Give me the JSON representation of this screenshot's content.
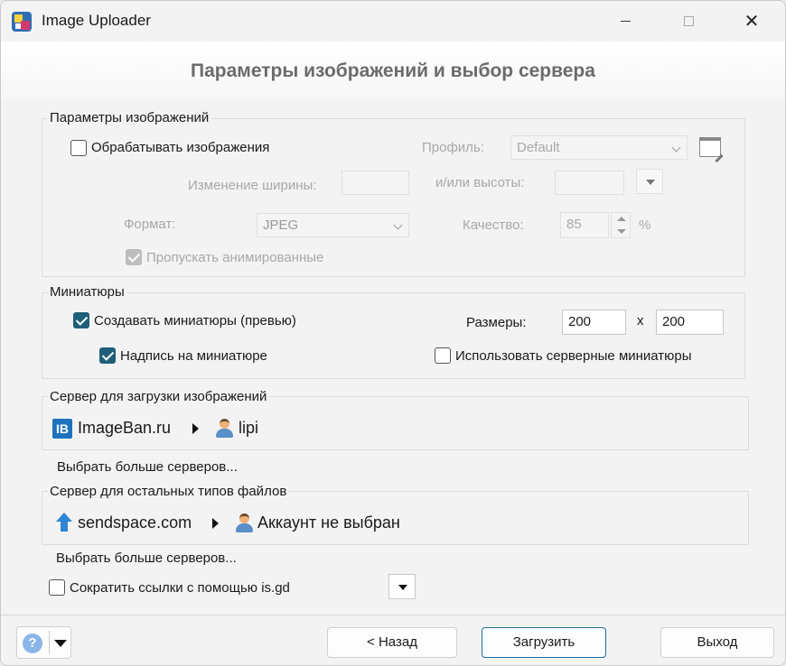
{
  "window": {
    "title": "Image Uploader",
    "header": "Параметры изображений и выбор сервера"
  },
  "image_params": {
    "group_label": "Параметры изображений",
    "process_label": "Обрабатывать изображения",
    "process_checked": false,
    "profile_label": "Профиль:",
    "profile_value": "Default",
    "width_label": "Изменение ширины:",
    "width_value": "",
    "height_label": "и/или высоты:",
    "height_value": "",
    "format_label": "Формат:",
    "format_value": "JPEG",
    "quality_label": "Качество:",
    "quality_value": "85",
    "quality_unit": "%",
    "skip_animated_label": "Пропускать анимированные",
    "skip_animated_checked": true
  },
  "thumbnails": {
    "group_label": "Миниатюры",
    "create_label": "Создавать миниатюры (превью)",
    "create_checked": true,
    "sizes_label": "Размеры:",
    "size_width": "200",
    "size_sep": "x",
    "size_height": "200",
    "caption_label": "Надпись на миниатюре",
    "caption_checked": true,
    "server_thumbs_label": "Использовать серверные миниатюры",
    "server_thumbs_checked": false
  },
  "image_server": {
    "group_label": "Сервер для загрузки изображений",
    "server_icon_text": "IB",
    "server_name": "ImageBan.ru",
    "account": "lipi",
    "more_link": "Выбрать больше серверов..."
  },
  "file_server": {
    "group_label": "Сервер для остальных типов файлов",
    "server_name": "sendspace.com",
    "account": "Аккаунт не выбран",
    "more_link": "Выбрать больше серверов..."
  },
  "shorten": {
    "label": "Сократить ссылки с помощью is.gd",
    "checked": false
  },
  "footer": {
    "help_symbol": "?",
    "back_label": "< Назад",
    "upload_label": "Загрузить",
    "exit_label": "Выход"
  }
}
